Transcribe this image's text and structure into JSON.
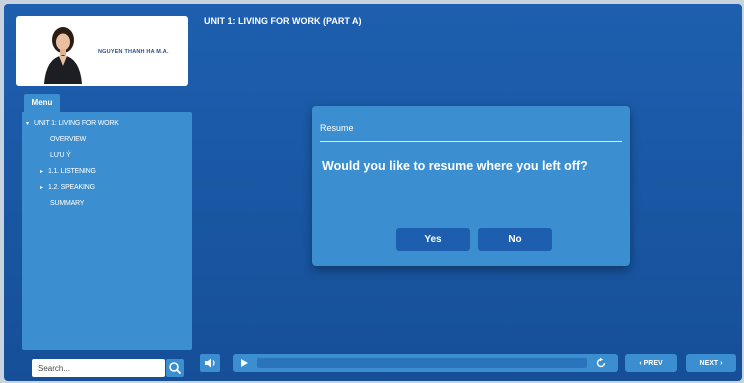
{
  "presenter": {
    "name": "NGUYEN THANH HA M.A."
  },
  "menu": {
    "tab_label": "Menu",
    "items": [
      {
        "label": "UNIT 1: LIVING FOR WORK",
        "expander": "▾"
      },
      {
        "label": "OVERVIEW"
      },
      {
        "label": "LƯU Ý"
      },
      {
        "label": "1.1. LISTENING",
        "expander": "▸"
      },
      {
        "label": "1.2. SPEAKING",
        "expander": "▸"
      },
      {
        "label": "SUMMARY"
      }
    ]
  },
  "search": {
    "placeholder": "Search..."
  },
  "slide": {
    "title": "UNIT 1: LIVING FOR WORK (PART A)"
  },
  "dialog": {
    "title": "Resume",
    "question": "Would you like to resume where you left off?",
    "yes_label": "Yes",
    "no_label": "No"
  },
  "controls": {
    "prev_label": "‹ PREV",
    "next_label": "NEXT ›",
    "progress": 0
  },
  "icons": {
    "search": "search-icon",
    "volume": "volume-icon",
    "play": "play-icon",
    "replay": "replay-icon"
  },
  "colors": {
    "background": "#1a58a5",
    "panel": "#3b8fd0",
    "button": "#1d5fae",
    "text": "#ffffff"
  }
}
